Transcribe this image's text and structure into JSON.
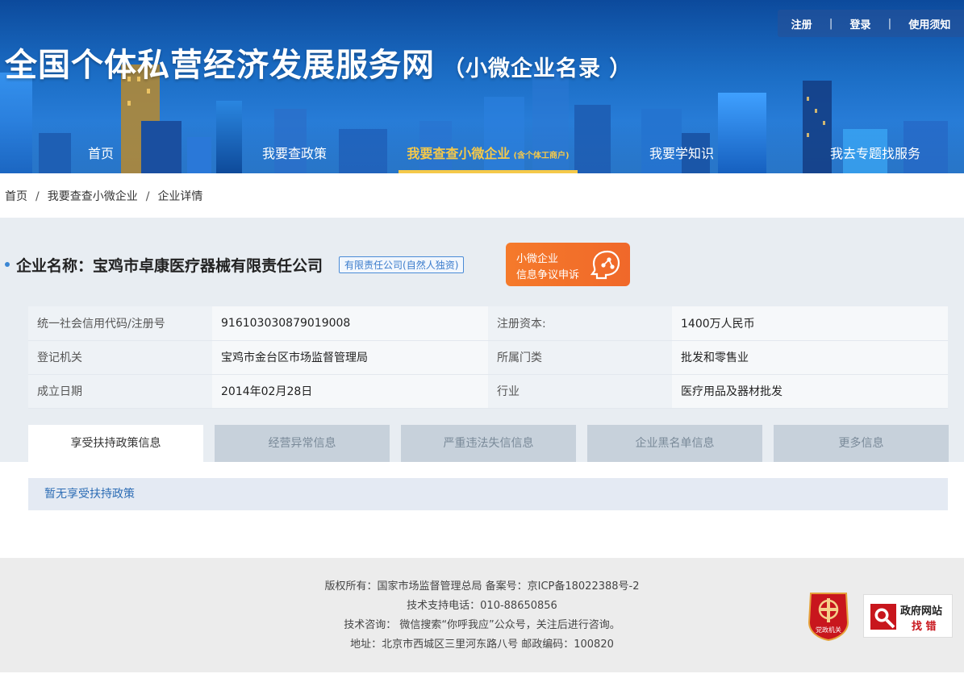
{
  "header": {
    "title": "全国个体私营经济发展服务网",
    "subtitle": "（小微企业名录 ）",
    "top_links": [
      "注册",
      "登录",
      "使用须知"
    ]
  },
  "nav": {
    "items": [
      {
        "label": "首页"
      },
      {
        "label": "我要查政策"
      },
      {
        "label": "我要查查小微企业",
        "small": "(含个体工商户)"
      },
      {
        "label": "我要学知识"
      },
      {
        "label": "我去专题找服务"
      }
    ]
  },
  "breadcrumb": [
    "首页",
    "我要查查小微企业",
    "企业详情"
  ],
  "company": {
    "label": "企业名称：",
    "name": "宝鸡市卓康医疗器械有限责任公司",
    "type_tag": "有限责任公司(自然人独资)",
    "appeal_line1": "小微企业",
    "appeal_line2": "信息争议申诉"
  },
  "info": {
    "rows": [
      {
        "k1": "统一社会信用代码/注册号",
        "v1": "916103030879019008",
        "k2": "注册资本:",
        "v2": "1400万人民币"
      },
      {
        "k1": "登记机关",
        "v1": "宝鸡市金台区市场监督管理局",
        "k2": "所属门类",
        "v2": "批发和零售业"
      },
      {
        "k1": "成立日期",
        "v1": "2014年02月28日",
        "k2": "行业",
        "v2": "医疗用品及器材批发"
      }
    ]
  },
  "tabs": [
    "享受扶持政策信息",
    "经营异常信息",
    "严重违法失信信息",
    "企业黑名单信息",
    "更多信息"
  ],
  "policy": {
    "empty_text": "暂无享受扶持政策"
  },
  "footer": {
    "lines": [
      "版权所有：国家市场监督管理总局 备案号：京ICP备18022388号-2",
      "技术支持电话：010-88650856",
      "技术咨询： 微信搜索“你呼我应”公众号，关注后进行咨询。",
      "地址：北京市西城区三里河东路八号 邮政编码：100820"
    ],
    "party_badge_text": "党政机关",
    "gov_badge_line1": "政府网站",
    "gov_badge_line2": "找 错"
  },
  "colors": {
    "header_blue": "#1565c0",
    "nav_active": "#f5c94a",
    "appeal_orange": "#f57a2b",
    "link_blue": "#2d6db5"
  }
}
